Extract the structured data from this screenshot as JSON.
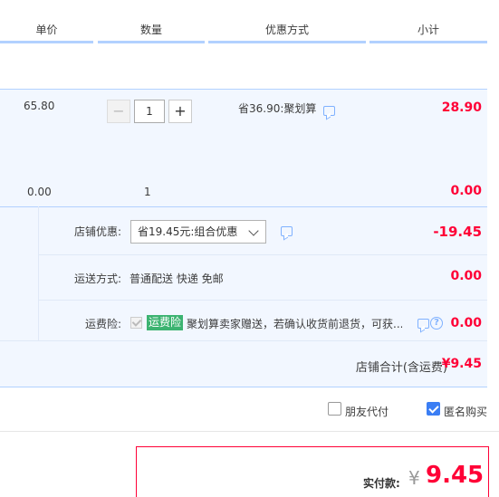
{
  "table_header": {
    "price": "单价",
    "quantity": "数量",
    "discount": "优惠方式",
    "subtotal": "小计"
  },
  "item": {
    "unit_price": "65.80",
    "quantity": "1",
    "discount_text": "省36.90:聚划算",
    "subtotal": "28.90",
    "minus_label": "−",
    "plus_label": "+"
  },
  "gift_item": {
    "unit_price": "0.00",
    "quantity": "1",
    "subtotal": "0.00"
  },
  "store_discount": {
    "label": "店铺优惠:",
    "selected": "省19.45元:组合优惠",
    "amount": "-19.45"
  },
  "shipping": {
    "label": "运送方式:",
    "value": "普通配送 快递 免邮",
    "amount": "0.00"
  },
  "insurance": {
    "label": "运费险:",
    "tag": "运费险",
    "description": "聚划算卖家赠送，若确认收货前退货，可获...",
    "amount": "0.00",
    "help_glyph": "?"
  },
  "store_total": {
    "label": "店铺合计(含运费)",
    "amount": "¥9.45"
  },
  "pay_options": {
    "friend_pay": "朋友代付",
    "friend_pay_checked": false,
    "anonymous": "匿名购买",
    "anonymous_checked": true
  },
  "payment": {
    "label": "实付款:",
    "currency": "¥",
    "amount": "9.45"
  },
  "colors": {
    "accent_red": "#ff0036",
    "header_border": "#b2d1ff",
    "row_bg": "#f2f7ff",
    "insurance_tag": "#3cb371",
    "checkbox_blue": "#3b7ef4"
  },
  "icons": {
    "comment": "comment-icon",
    "help": "help-icon",
    "chevron": "chevron-down-icon"
  }
}
